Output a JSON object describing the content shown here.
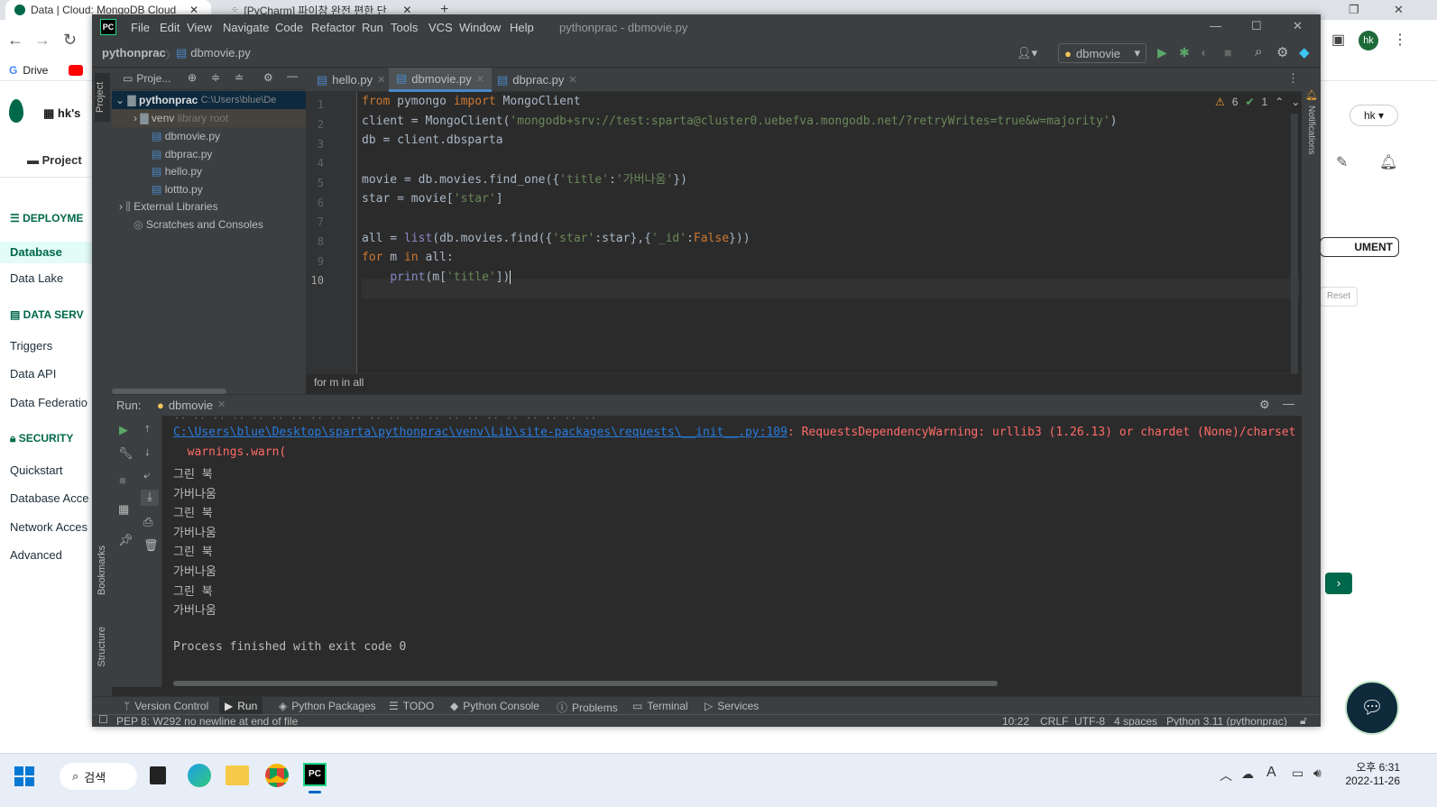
{
  "browser": {
    "tabs": [
      {
        "label": "Data | Cloud: MongoDB Cloud",
        "active": true
      },
      {
        "label": "[PyCharm] 파이참 완전 편한 단",
        "active": false
      }
    ],
    "bookmarks": [
      "Drive"
    ],
    "profile_initials": "hk"
  },
  "mongo": {
    "org_label": "hk's",
    "project_label": "Project",
    "sections": [
      {
        "title": "DEPLOYME",
        "items": [
          "Database",
          "Data Lake"
        ]
      },
      {
        "title": "DATA SERV",
        "items": [
          "Triggers",
          "Data API",
          "Data Federatio"
        ]
      },
      {
        "title": "SECURITY",
        "items": [
          "Quickstart",
          "Database Acce",
          "Network Acces",
          "Advanced"
        ]
      }
    ],
    "right_user": "hk",
    "right_button": "UMENT",
    "reset_label": "Reset"
  },
  "ide": {
    "menu": [
      "File",
      "Edit",
      "View",
      "Navigate",
      "Code",
      "Refactor",
      "Run",
      "Tools",
      "VCS",
      "Window",
      "Help"
    ],
    "window_title": "pythonprac - dbmovie.py",
    "nav": {
      "project": "pythonprac",
      "file": "dbmovie.py",
      "run_config": "dbmovie"
    },
    "project_panel_title": "Proje...",
    "tree": [
      {
        "label": "pythonprac",
        "hint": "C:\\Users\\blue\\De",
        "level": 0,
        "bold": true
      },
      {
        "label": "venv",
        "hint": "library root",
        "level": 1
      },
      {
        "label": "dbmovie.py",
        "level": 2
      },
      {
        "label": "dbprac.py",
        "level": 2
      },
      {
        "label": "hello.py",
        "level": 2
      },
      {
        "label": "lottto.py",
        "level": 2
      },
      {
        "label": "External Libraries",
        "level": 0
      },
      {
        "label": "Scratches and Consoles",
        "level": 0
      }
    ],
    "editor_tabs": [
      "hello.py",
      "dbmovie.py",
      "dbprac.py"
    ],
    "active_tab": 1,
    "inspections": {
      "warnings": "6",
      "ok": "1"
    },
    "code": [
      "from pymongo import MongoClient",
      "client = MongoClient('mongodb+srv://test:sparta@cluster0.uebefva.mongodb.net/?retryWrites=true&w=majority')",
      "db = client.dbsparta",
      "",
      "movie = db.movies.find_one({'title':'가버나움'})",
      "star = movie['star']",
      "",
      "all = list(db.movies.find({'star':star},{'_id':False}))",
      "for m in all:",
      "    print(m['title'])"
    ],
    "breadcrumb": "for m in all",
    "run": {
      "label": "Run:",
      "config": "dbmovie",
      "output": [
        {
          "type": "err-link",
          "link": "C:\\Users\\blue\\Desktop\\sparta\\pythonprac\\venv\\Lib\\site-packages\\requests\\__init__.py:109",
          "text": ": RequestsDependencyWarning: urllib3 (1.26.13) or chardet (None)/charset"
        },
        {
          "type": "err",
          "text": "  warnings.warn("
        },
        {
          "type": "out",
          "text": "그린 북"
        },
        {
          "type": "out",
          "text": "가버나움"
        },
        {
          "type": "out",
          "text": "그린 북"
        },
        {
          "type": "out",
          "text": "가버나움"
        },
        {
          "type": "out",
          "text": "그린 북"
        },
        {
          "type": "out",
          "text": "가버나움"
        },
        {
          "type": "out",
          "text": "그린 북"
        },
        {
          "type": "out",
          "text": "가버나움"
        },
        {
          "type": "out",
          "text": ""
        },
        {
          "type": "out",
          "text": "Process finished with exit code 0"
        }
      ]
    },
    "bottom_tabs": [
      "Version Control",
      "Run",
      "Python Packages",
      "TODO",
      "Python Console",
      "Problems",
      "Terminal",
      "Services"
    ],
    "status_left": "PEP 8: W292 no newline at end of file",
    "status_right": [
      "10:22",
      "CRLF",
      "UTF-8",
      "4 spaces",
      "Python 3.11 (pythonprac)"
    ],
    "side_labels": {
      "project": "Project",
      "bookmarks": "Bookmarks",
      "structure": "Structure",
      "notifications": "Notifications"
    }
  },
  "taskbar": {
    "search": "검색",
    "time": "오후 6:31",
    "date": "2022-11-26"
  }
}
